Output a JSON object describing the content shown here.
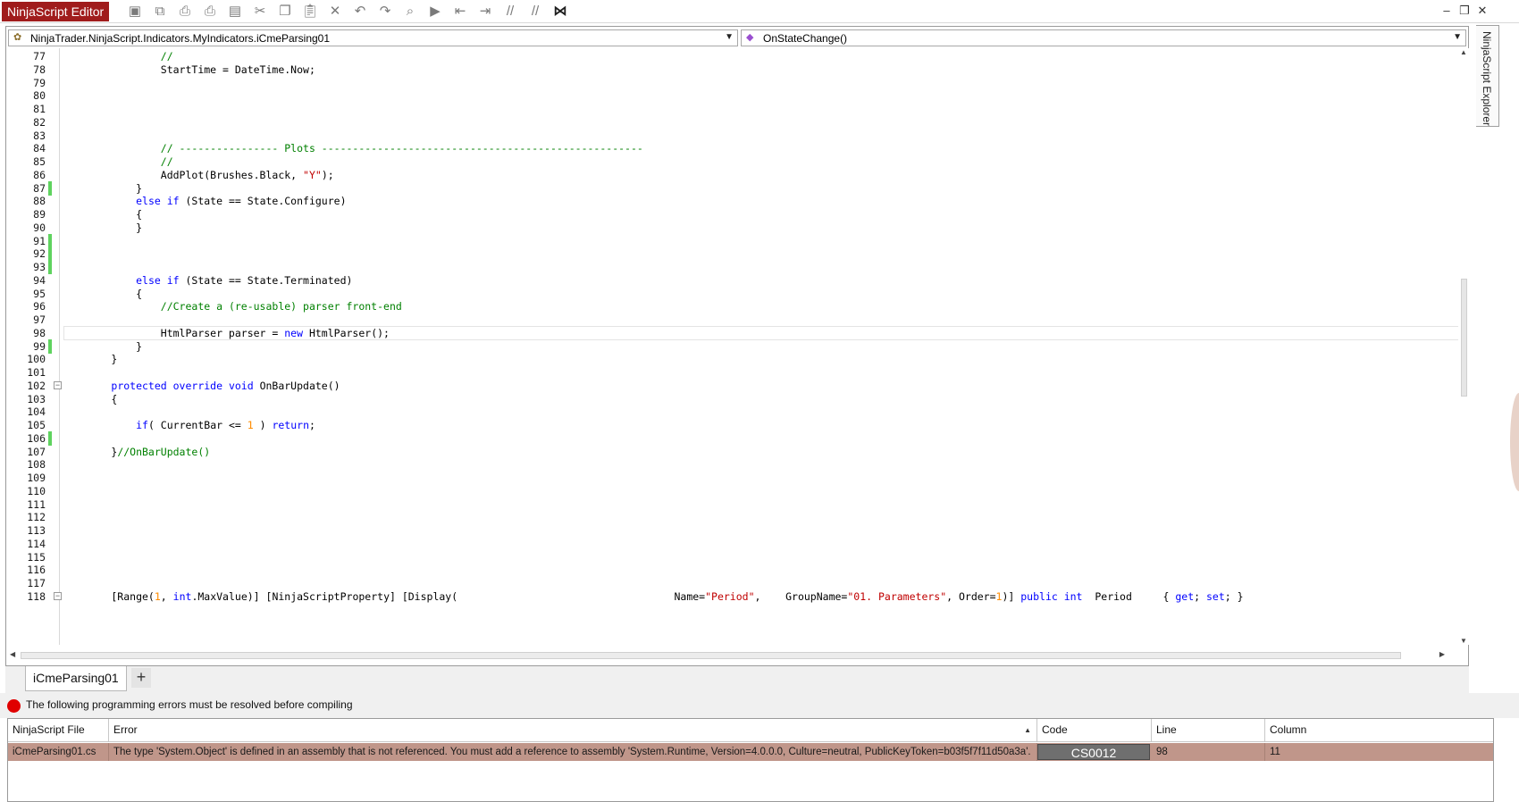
{
  "app": {
    "title": "NinjaScript Editor"
  },
  "toolbar": {
    "icons": [
      "save-icon",
      "save-all-icon",
      "print-icon",
      "print-preview-icon",
      "properties-icon",
      "cut-icon",
      "copy-icon",
      "paste-icon",
      "delete-icon",
      "undo-icon",
      "redo-icon",
      "find-icon",
      "compile-icon",
      "outdent-icon",
      "indent-icon",
      "comment-icon",
      "uncomment-icon",
      "visual-studio-icon"
    ]
  },
  "window_controls": {
    "minimize": "‒",
    "restore": "❐",
    "close": "✕"
  },
  "explorer_tab": {
    "label": "NinjaScript Explorer"
  },
  "editor": {
    "class_combo": "NinjaTrader.NinjaScript.Indicators.MyIndicators.iCmeParsing01",
    "member_combo": "OnStateChange()",
    "current_line": 98,
    "lines": [
      {
        "n": "77",
        "html": "                <span class=\"cm\">//</span>"
      },
      {
        "n": "78",
        "html": "                StartTime = DateTime.Now;"
      },
      {
        "n": "79",
        "html": ""
      },
      {
        "n": "80",
        "html": ""
      },
      {
        "n": "81",
        "html": ""
      },
      {
        "n": "82",
        "html": ""
      },
      {
        "n": "83",
        "html": ""
      },
      {
        "n": "84",
        "html": "                <span class=\"cm\">// ---------------- Plots ----------------------------------------------------</span>"
      },
      {
        "n": "85",
        "html": "                <span class=\"cm\">//</span>"
      },
      {
        "n": "86",
        "html": "                AddPlot(Brushes.Black, <span class=\"st\">\"Y\"</span>);"
      },
      {
        "n": "87",
        "html": "            }",
        "chg": true
      },
      {
        "n": "88",
        "html": "            <span class=\"kw\">else if</span> (State == State.Configure)"
      },
      {
        "n": "89",
        "html": "            {"
      },
      {
        "n": "90",
        "html": "            }"
      },
      {
        "n": "91",
        "html": "",
        "chg": true
      },
      {
        "n": "92",
        "html": "",
        "chg": true
      },
      {
        "n": "93",
        "html": "",
        "chg": true
      },
      {
        "n": "94",
        "html": "            <span class=\"kw\">else if</span> (State == State.Terminated)"
      },
      {
        "n": "95",
        "html": "            {"
      },
      {
        "n": "96",
        "html": "                <span class=\"cm\">//Create a (re-usable) parser front-end</span>"
      },
      {
        "n": "97",
        "html": ""
      },
      {
        "n": "98",
        "html": "                HtmlParser parser = <span class=\"kw\">new</span> HtmlParser();"
      },
      {
        "n": "99",
        "html": "            }",
        "chg": true
      },
      {
        "n": "100",
        "html": "        }"
      },
      {
        "n": "101",
        "html": ""
      },
      {
        "n": "102",
        "html": "        <span class=\"kw\">protected override void</span> OnBarUpdate()",
        "fold": true
      },
      {
        "n": "103",
        "html": "        {"
      },
      {
        "n": "104",
        "html": ""
      },
      {
        "n": "105",
        "html": "            <span class=\"kw\">if</span>( CurrentBar &lt;= <span class=\"nm\">1</span> ) <span class=\"kw\">return</span>;"
      },
      {
        "n": "106",
        "html": "",
        "chg": true
      },
      {
        "n": "107",
        "html": "        }<span class=\"cm\">//OnBarUpdate()</span>"
      },
      {
        "n": "108",
        "html": ""
      },
      {
        "n": "109",
        "html": ""
      },
      {
        "n": "110",
        "html": ""
      },
      {
        "n": "111",
        "html": ""
      },
      {
        "n": "112",
        "html": ""
      },
      {
        "n": "113",
        "html": ""
      },
      {
        "n": "114",
        "html": ""
      },
      {
        "n": "115",
        "html": ""
      },
      {
        "n": "116",
        "html": ""
      },
      {
        "n": "117",
        "html": ""
      },
      {
        "n": "118",
        "html": "        [Range(<span class=\"nm\">1</span>, <span class=\"kw\">int</span>.MaxValue)] [NinjaScriptProperty] [Display(                                   Name=<span class=\"st\">\"Period\"</span>,    GroupName=<span class=\"st\">\"01. Parameters\"</span>, Order=<span class=\"nm\">1</span>)] <span class=\"kw\">public int</span>  Period     { <span class=\"kw\">get</span>; <span class=\"kw\">set</span>; }",
        "fold": true
      }
    ]
  },
  "tabs": {
    "active": "iCmeParsing01",
    "add_label": "+"
  },
  "errors": {
    "message": "The following programming errors must be resolved before compiling",
    "columns": [
      "NinjaScript File",
      "Error",
      "Code",
      "Line",
      "Column"
    ],
    "rows": [
      {
        "file": "iCmeParsing01.cs",
        "error": "The type 'System.Object' is defined in an assembly that is not referenced. You must add a reference to assembly 'System.Runtime, Version=4.0.0.0, Culture=neutral, PublicKeyToken=b03f5f7f11d50a3a'.",
        "code": "CS0012",
        "line": "98",
        "column": "11"
      }
    ]
  }
}
